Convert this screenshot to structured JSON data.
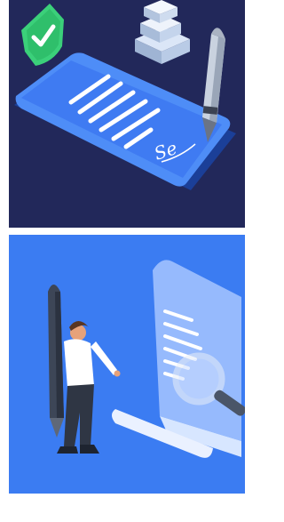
{
  "illustrations": {
    "top": {
      "icon": "signing-contract-on-phone-illustration",
      "signature_text": "Se",
      "colors": {
        "background": "#22285a",
        "device": "#3f7bf2",
        "shield": "#2fbf6b"
      }
    },
    "bottom": {
      "icon": "reviewing-document-with-magnifier-illustration",
      "colors": {
        "background": "#3b7cf2",
        "document": "#8fb6ff"
      }
    }
  }
}
